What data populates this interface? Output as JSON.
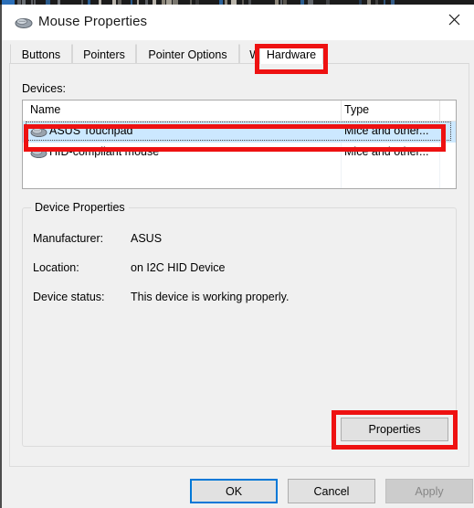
{
  "window": {
    "title": "Mouse Properties",
    "title_icon": "mouse-icon",
    "close_icon": "close-icon"
  },
  "tabs": [
    {
      "label": "Buttons",
      "active": false
    },
    {
      "label": "Pointers",
      "active": false
    },
    {
      "label": "Pointer Options",
      "active": false
    },
    {
      "label": "Wheel",
      "active": false
    },
    {
      "label": "Hardware",
      "active": true
    }
  ],
  "devices_section": {
    "label": "Devices:",
    "columns": [
      "Name",
      "Type"
    ],
    "rows": [
      {
        "icon": "mouse-icon",
        "name": "ASUS Touchpad",
        "type": "Mice and other...",
        "selected": true
      },
      {
        "icon": "mouse-icon",
        "name": "HID-compliant mouse",
        "type": "Mice and other...",
        "selected": false
      }
    ]
  },
  "device_properties": {
    "legend": "Device Properties",
    "fields": [
      {
        "label": "Manufacturer:",
        "value": "ASUS"
      },
      {
        "label": "Location:",
        "value": "on I2C HID Device"
      },
      {
        "label": "Device status:",
        "value": "This device is working properly."
      }
    ],
    "properties_button": "Properties"
  },
  "footer": {
    "ok": "OK",
    "cancel": "Cancel",
    "apply": "Apply"
  },
  "annotations": {
    "color": "#ee1111",
    "targets": [
      "hardware-tab",
      "asus-touchpad-row",
      "properties-button"
    ]
  },
  "colors": {
    "dialog_background": "#f0f0f0",
    "titlebar": "#ffffff",
    "selection": "#cce8ff",
    "default_button_focus": "#0078d7",
    "annotation_red": "#ee1111",
    "disabled_text": "#868686"
  }
}
